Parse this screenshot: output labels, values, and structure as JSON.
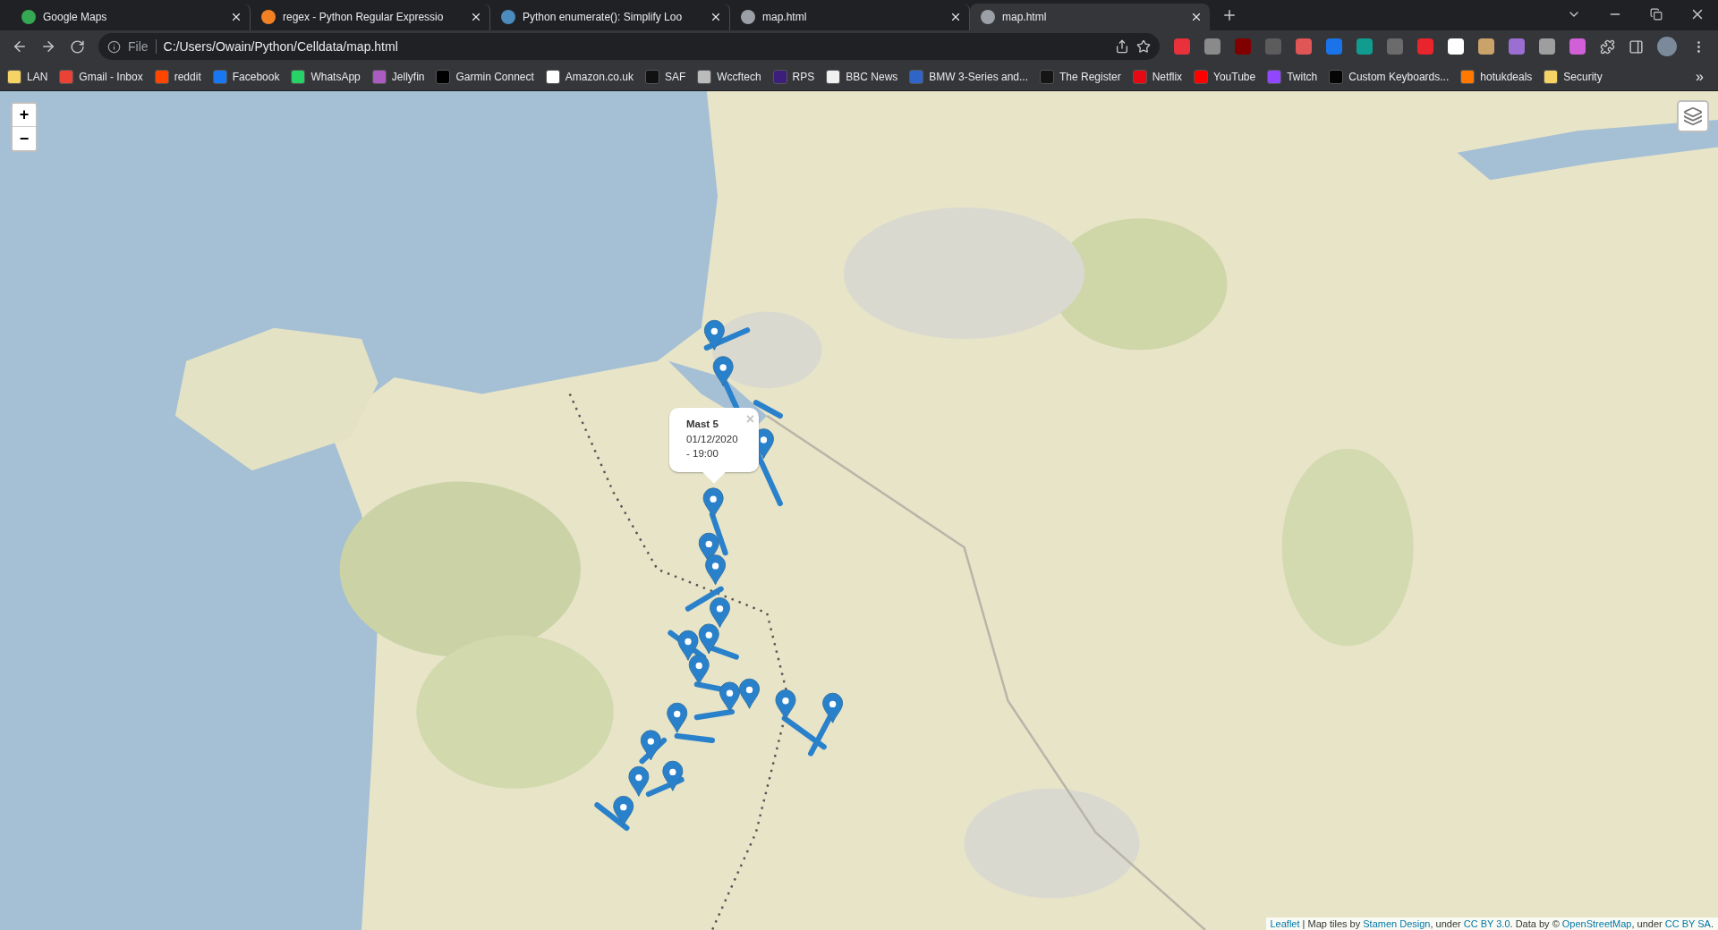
{
  "tabs": [
    {
      "title": "Google Maps",
      "selected": false,
      "color": "#34a853"
    },
    {
      "title": "regex - Python Regular Expressio",
      "selected": false,
      "color": "#f48024"
    },
    {
      "title": "Python enumerate(): Simplify Loo",
      "selected": false,
      "color": "#4b8bbe"
    },
    {
      "title": "map.html",
      "selected": false,
      "color": "#9aa0a6"
    },
    {
      "title": "map.html",
      "selected": true,
      "color": "#9aa0a6"
    }
  ],
  "address": {
    "scheme": "File",
    "url": "C:/Users/Owain/Python/Celldata/map.html"
  },
  "extensions": [
    {
      "color": "#e8313b"
    },
    {
      "color": "#8a8a8a"
    },
    {
      "color": "#800000"
    },
    {
      "color": "#5c5c5c"
    },
    {
      "color": "#e05555"
    },
    {
      "color": "#1a73e8"
    },
    {
      "color": "#109d8f"
    },
    {
      "color": "#6b6b6b"
    },
    {
      "color": "#e8242c"
    },
    {
      "color": "#ffffff"
    },
    {
      "color": "#c9a36a"
    },
    {
      "color": "#9b6fd1"
    },
    {
      "color": "#9e9e9e"
    },
    {
      "color": "#d05fd8"
    }
  ],
  "bookmarks": [
    {
      "label": "LAN",
      "color": "#f6d365"
    },
    {
      "label": "Gmail - Inbox",
      "color": "#ea4335"
    },
    {
      "label": "reddit",
      "color": "#ff4500"
    },
    {
      "label": "Facebook",
      "color": "#1877f2"
    },
    {
      "label": "WhatsApp",
      "color": "#25d366"
    },
    {
      "label": "Jellyfin",
      "color": "#aa5cc3"
    },
    {
      "label": "Garmin Connect",
      "color": "#000000"
    },
    {
      "label": "Amazon.co.uk",
      "color": "#ffffff"
    },
    {
      "label": "SAF",
      "color": "#111111"
    },
    {
      "label": "Wccftech",
      "color": "#bbbbbb"
    },
    {
      "label": "RPS",
      "color": "#3b1f7a"
    },
    {
      "label": "BBC News",
      "color": "#f0f0f0"
    },
    {
      "label": "BMW 3-Series and...",
      "color": "#2f64c8"
    },
    {
      "label": "The Register",
      "color": "#151515"
    },
    {
      "label": "Netflix",
      "color": "#e50914"
    },
    {
      "label": "YouTube",
      "color": "#ff0000"
    },
    {
      "label": "Twitch",
      "color": "#9146ff"
    },
    {
      "label": "Custom Keyboards...",
      "color": "#050505"
    },
    {
      "label": "hotukdeals",
      "color": "#ff7900"
    },
    {
      "label": "Security",
      "color": "#f6d365"
    }
  ],
  "bookmarks_more": "»",
  "map": {
    "zoom_in": "+",
    "zoom_out": "−",
    "popup": {
      "title": "Mast 5",
      "date": "01/12/2020",
      "time": "- 19:00",
      "close": "×"
    },
    "attribution": [
      {
        "text": "Leaflet",
        "link": true
      },
      {
        "text": " | Map tiles by ",
        "link": false
      },
      {
        "text": "Stamen Design",
        "link": true
      },
      {
        "text": ", under ",
        "link": false
      },
      {
        "text": "CC BY 3.0",
        "link": true
      },
      {
        "text": ". Data by © ",
        "link": false
      },
      {
        "text": "OpenStreetMap",
        "link": true
      },
      {
        "text": ", under ",
        "link": false
      },
      {
        "text": "CC BY SA",
        "link": true
      }
    ],
    "attribution_end": "."
  }
}
